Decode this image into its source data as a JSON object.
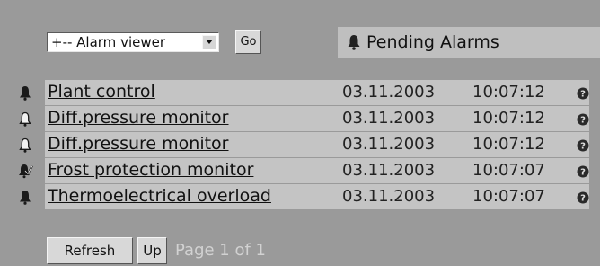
{
  "toolbar": {
    "select_value": "+-- Alarm viewer",
    "go_label": "Go"
  },
  "pending": {
    "label": "Pending Alarms",
    "icon": "bell-icon"
  },
  "alarms": [
    {
      "name": "Plant control",
      "date": "03.11.2003",
      "time": "10:07:12",
      "icon": "bell-solid-icon"
    },
    {
      "name": "Diff.pressure monitor",
      "date": "03.11.2003",
      "time": "10:07:12",
      "icon": "bell-outline-icon"
    },
    {
      "name": "Diff.pressure monitor",
      "date": "03.11.2003",
      "time": "10:07:12",
      "icon": "bell-outline-icon"
    },
    {
      "name": "Frost protection monitor",
      "date": "03.11.2003",
      "time": "10:07:07",
      "icon": "bell-acknowledged-icon"
    },
    {
      "name": "Thermoelectrical overload",
      "date": "03.11.2003",
      "time": "10:07:07",
      "icon": "bell-solid-icon"
    }
  ],
  "footer": {
    "refresh_label": "Refresh",
    "up_label": "Up",
    "page_info": "Page 1 of 1"
  }
}
